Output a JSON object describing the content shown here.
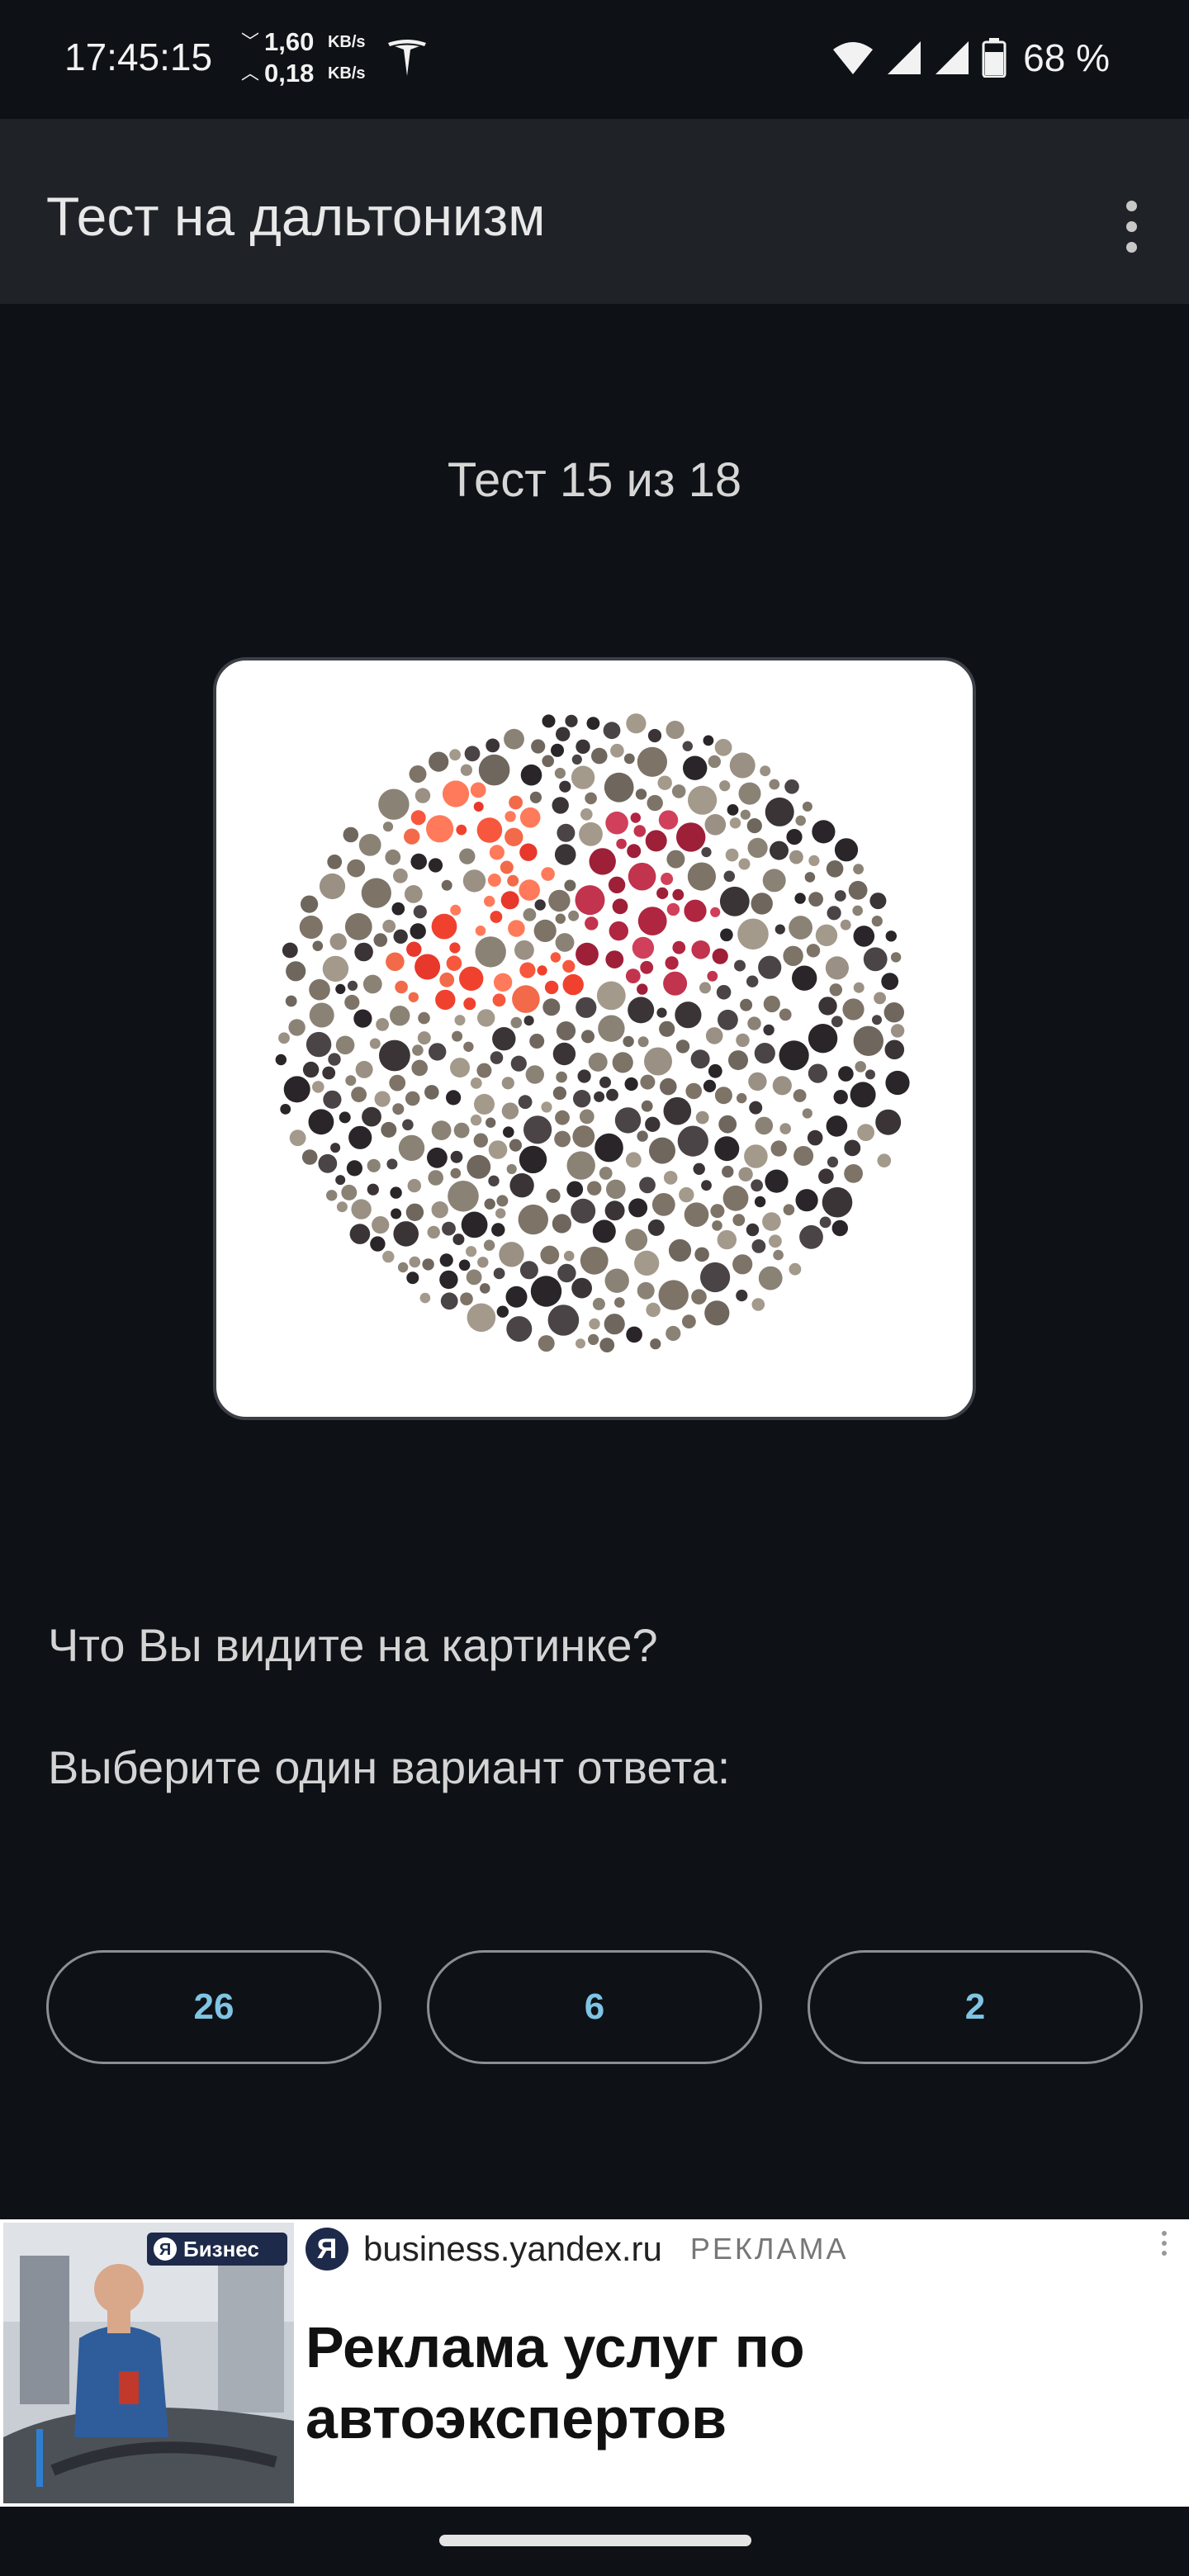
{
  "status_bar": {
    "time": "17:45:15",
    "download_speed": "1,60",
    "upload_speed": "0,18",
    "speed_unit": "KB/s",
    "battery_percent": "68 %",
    "icons": [
      "tesla-icon",
      "wifi-icon",
      "signal-icon",
      "signal-icon",
      "battery-icon"
    ]
  },
  "app_bar": {
    "title": "Тест на дальтонизм",
    "menu_icon": "more-vert-icon"
  },
  "test": {
    "counter": "Тест 15 из 18",
    "question": "Что Вы видите на картинке?",
    "instruction": "Выберите один вариант ответа:",
    "answers": [
      "26",
      "6",
      "2"
    ],
    "colors": {
      "answer_text": "#7fc4e4",
      "background": "#0e1115",
      "app_bar": "#1f2328"
    }
  },
  "ad": {
    "badge": "Бизнес",
    "logo_letter": "Я",
    "domain": "business.yandex.ru",
    "label": "РЕКЛАМА",
    "headline": "Реклама услуг по автоэкспертов"
  }
}
